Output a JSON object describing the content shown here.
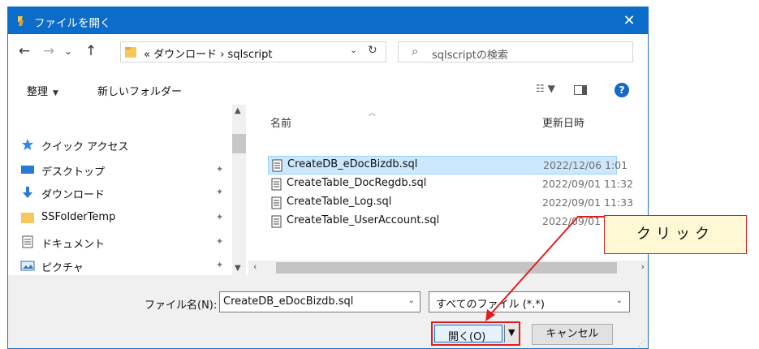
{
  "window": {
    "title": "ファイルを開く",
    "close_glyph": "✕"
  },
  "nav": {
    "back_glyph": "←",
    "forward_glyph": "→",
    "recent_glyph": "⌄",
    "up_glyph": "↑",
    "breadcrumb": "«  ダウンロード  ›  sqlscript",
    "address_dropdown_glyph": "⌄",
    "refresh_glyph": "↻",
    "search_placeholder": "sqlscriptの検索"
  },
  "toolbar": {
    "organize_label": "整理",
    "new_folder_label": "新しいフォルダー",
    "help_glyph": "?"
  },
  "sidebar": {
    "items": [
      {
        "label": "クイック アクセス",
        "icon": "star-icon"
      },
      {
        "label": "デスクトップ",
        "icon": "desktop-icon"
      },
      {
        "label": "ダウンロード",
        "icon": "download-icon"
      },
      {
        "label": "SSFolderTemp",
        "icon": "folder-icon"
      },
      {
        "label": "ドキュメント",
        "icon": "document-icon"
      },
      {
        "label": "ピクチャ",
        "icon": "pictures-icon"
      }
    ],
    "pin_glyph": "📌"
  },
  "file_list": {
    "columns": {
      "name": "名前",
      "modified": "更新日時"
    },
    "rows": [
      {
        "name": "CreateDB_eDocBizdb.sql",
        "modified": "2022/12/06 1:01",
        "selected": true
      },
      {
        "name": "CreateTable_DocRegdb.sql",
        "modified": "2022/09/01 11:32",
        "selected": false
      },
      {
        "name": "CreateTable_Log.sql",
        "modified": "2022/09/01 11:33",
        "selected": false
      },
      {
        "name": "CreateTable_UserAccount.sql",
        "modified": "2022/09/01",
        "selected": false
      }
    ]
  },
  "bottom": {
    "filename_label": "ファイル名(N):",
    "filename_value": "CreateDB_eDocBizdb.sql",
    "filetype_value": "すべてのファイル (*.*)",
    "open_label": "開く(O)",
    "cancel_label": "キャンセル"
  },
  "annotation": {
    "text": "クリック"
  },
  "colors": {
    "titlebar": "#0b6cc9",
    "selection": "#cce8ff",
    "highlight": "#e21d1d",
    "callout_bg": "#fff8d4"
  }
}
